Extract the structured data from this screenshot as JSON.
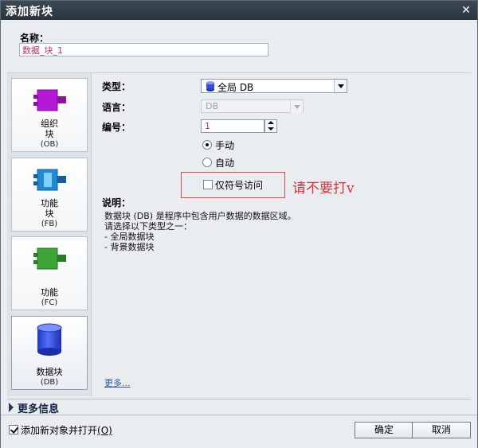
{
  "window": {
    "title": "添加新块",
    "close_icon": "✕"
  },
  "name": {
    "label": "名称：",
    "value": "数据_块_1"
  },
  "block_types": [
    {
      "label": "组织\n块",
      "sub": "(OB)",
      "icon": "ob-block-icon",
      "color": "#b418d9"
    },
    {
      "label": "功能\n块",
      "sub": "(FB)",
      "icon": "fb-block-icon",
      "color": "#1f8ad8"
    },
    {
      "label": "功能",
      "sub": "(FC)",
      "icon": "fc-block-icon",
      "color": "#3aa534"
    },
    {
      "label": "数据块",
      "sub": "(DB)",
      "icon": "db-block-icon",
      "color": "#2d4fd8",
      "selected": true
    }
  ],
  "form": {
    "type_label": "类型：",
    "type_value": "全局 DB",
    "language_label": "语言：",
    "language_value": "DB",
    "number_label": "编号：",
    "number_value": "1",
    "manual_label": "手动",
    "auto_label": "自动",
    "selected_numbering": "手动",
    "optimized_label": "仅符号访问",
    "annotation": "请不要打v",
    "description_label": "说明：",
    "description_lines": [
      "数据块 (DB) 是程序中包含用户数据的数据区域。",
      "请选择以下类型之一：",
      "- 全局数据块",
      "- 背景数据块"
    ],
    "more_link": "更多..."
  },
  "more_info": {
    "label": "更多信息"
  },
  "footer": {
    "open_label": "添加新对象并打开",
    "open_accel": "(O)",
    "ok_label": "确定",
    "cancel_label": "取消"
  },
  "colors": {
    "annotation": "#e0303a",
    "value_text": "#c0306a",
    "link": "#2d5aa0"
  }
}
